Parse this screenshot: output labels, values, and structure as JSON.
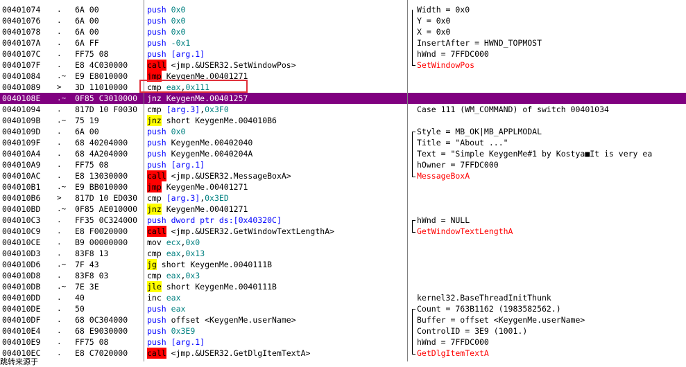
{
  "rows": [
    {
      "addr": "00401074",
      "arrow": ".",
      "hex": "6A 00",
      "mn": "push",
      "mnClass": "mn-push",
      "ops": [
        [
          "0x0",
          "op-imm"
        ]
      ],
      "cmt": "Width = 0x0"
    },
    {
      "addr": "00401076",
      "arrow": ".",
      "hex": "6A 00",
      "mn": "push",
      "mnClass": "mn-push",
      "ops": [
        [
          "0x0",
          "op-imm"
        ]
      ],
      "cmt": "Y = 0x0"
    },
    {
      "addr": "00401078",
      "arrow": ".",
      "hex": "6A 00",
      "mn": "push",
      "mnClass": "mn-push",
      "ops": [
        [
          "0x0",
          "op-imm"
        ]
      ],
      "cmt": "X = 0x0"
    },
    {
      "addr": "0040107A",
      "arrow": ".",
      "hex": "6A FF",
      "mn": "push",
      "mnClass": "mn-push",
      "ops": [
        [
          "-0x1",
          "op-imm"
        ]
      ],
      "cmt": "InsertAfter = HWND_TOPMOST"
    },
    {
      "addr": "0040107C",
      "arrow": ".",
      "hex": "FF75 08",
      "mn": "push",
      "mnClass": "mn-push",
      "ops": [
        [
          "[arg.1]",
          "op-mem"
        ]
      ],
      "cmt": "hWnd = 7FFDC000"
    },
    {
      "addr": "0040107F",
      "arrow": ".",
      "hex": "E8 4C030000",
      "mn": "call",
      "mnClass": "mn-call",
      "ops": [
        [
          "<jmp.&USER32.SetWindowPos>",
          "op-txt"
        ]
      ],
      "cmt": "SetWindowPos",
      "cmtClass": "cmt-red"
    },
    {
      "addr": "00401084",
      "arrow": ".~",
      "hex": "E9 E8010000",
      "mn": "jmp",
      "mnClass": "mn-jmp",
      "ops": [
        [
          "KeygenMe.00401271",
          "op-txt"
        ]
      ],
      "cmt": ""
    },
    {
      "addr": "00401089",
      "arrow": ">",
      "hex": "3D 11010000",
      "mn": "cmp",
      "mnClass": "mn-cmp",
      "ops": [
        [
          "eax",
          "op-reg"
        ],
        [
          ",",
          "op-txt"
        ],
        [
          "0x111",
          "op-imm"
        ]
      ],
      "cmt": ""
    },
    {
      "addr": "0040108E",
      "arrow": ".~",
      "hex": "0F85 C3010000",
      "mn": "jnz",
      "mnClass": "mn-jcc",
      "ops": [
        [
          "KeygenMe.00401257",
          "op-txt"
        ]
      ],
      "cmt": "",
      "selected": true
    },
    {
      "addr": "00401094",
      "arrow": ".",
      "hex": "817D 10 F0030",
      "mn": "cmp",
      "mnClass": "mn-cmp",
      "ops": [
        [
          "[arg.3]",
          "op-mem"
        ],
        [
          ",",
          "op-txt"
        ],
        [
          "0x3F0",
          "op-imm"
        ]
      ],
      "cmt": "Case 111 (WM_COMMAND) of switch 00401034"
    },
    {
      "addr": "0040109B",
      "arrow": ".~",
      "hex": "75 19",
      "mn": "jnz",
      "mnClass": "mn-jcc",
      "ops": [
        [
          "short KeygenMe.004010B6",
          "op-txt"
        ]
      ],
      "cmt": ""
    },
    {
      "addr": "0040109D",
      "arrow": ".",
      "hex": "6A 00",
      "mn": "push",
      "mnClass": "mn-push",
      "ops": [
        [
          "0x0",
          "op-imm"
        ]
      ],
      "cmt": "Style = MB_OK|MB_APPLMODAL"
    },
    {
      "addr": "0040109F",
      "arrow": ".",
      "hex": "68 40204000",
      "mn": "push",
      "mnClass": "mn-push",
      "ops": [
        [
          "KeygenMe.00402040",
          "op-txt"
        ]
      ],
      "cmt": "Title = \"About ...\""
    },
    {
      "addr": "004010A4",
      "arrow": ".",
      "hex": "68 4A204000",
      "mn": "push",
      "mnClass": "mn-push",
      "ops": [
        [
          "KeygenMe.0040204A",
          "op-txt"
        ]
      ],
      "cmt": "Text = \"Simple KeygenMe#1 by Kostya■It is very ea"
    },
    {
      "addr": "004010A9",
      "arrow": ".",
      "hex": "FF75 08",
      "mn": "push",
      "mnClass": "mn-push",
      "ops": [
        [
          "[arg.1]",
          "op-mem"
        ]
      ],
      "cmt": "hOwner = 7FFDC000"
    },
    {
      "addr": "004010AC",
      "arrow": ".",
      "hex": "E8 13030000",
      "mn": "call",
      "mnClass": "mn-call",
      "ops": [
        [
          "<jmp.&USER32.MessageBoxA>",
          "op-txt"
        ]
      ],
      "cmt": "MessageBoxA",
      "cmtClass": "cmt-red"
    },
    {
      "addr": "004010B1",
      "arrow": ".~",
      "hex": "E9 BB010000",
      "mn": "jmp",
      "mnClass": "mn-jmp",
      "ops": [
        [
          "KeygenMe.00401271",
          "op-txt"
        ]
      ],
      "cmt": ""
    },
    {
      "addr": "004010B6",
      "arrow": ">",
      "hex": "817D 10 ED030",
      "mn": "cmp",
      "mnClass": "mn-cmp",
      "ops": [
        [
          "[arg.3]",
          "op-mem"
        ],
        [
          ",",
          "op-txt"
        ],
        [
          "0x3ED",
          "op-imm"
        ]
      ],
      "cmt": ""
    },
    {
      "addr": "004010BD",
      "arrow": ".~",
      "hex": "0F85 AE010000",
      "mn": "jnz",
      "mnClass": "mn-jcc",
      "ops": [
        [
          "KeygenMe.00401271",
          "op-txt"
        ]
      ],
      "cmt": ""
    },
    {
      "addr": "004010C3",
      "arrow": ".",
      "hex": "FF35 0C324000",
      "mn": "push",
      "mnClass": "mn-push",
      "ops": [
        [
          "dword ptr ds:[0x40320C]",
          "op-mem"
        ]
      ],
      "cmt": "hWnd = NULL"
    },
    {
      "addr": "004010C9",
      "arrow": ".",
      "hex": "E8 F0020000",
      "mn": "call",
      "mnClass": "mn-call",
      "ops": [
        [
          "<jmp.&USER32.GetWindowTextLengthA>",
          "op-txt"
        ]
      ],
      "cmt": "GetWindowTextLengthA",
      "cmtClass": "cmt-red"
    },
    {
      "addr": "004010CE",
      "arrow": ".",
      "hex": "B9 00000000",
      "mn": "mov",
      "mnClass": "mn-mov",
      "ops": [
        [
          "ecx",
          "op-reg"
        ],
        [
          ",",
          "op-txt"
        ],
        [
          "0x0",
          "op-imm"
        ]
      ],
      "cmt": ""
    },
    {
      "addr": "004010D3",
      "arrow": ".",
      "hex": "83F8 13",
      "mn": "cmp",
      "mnClass": "mn-cmp",
      "ops": [
        [
          "eax",
          "op-reg"
        ],
        [
          ",",
          "op-txt"
        ],
        [
          "0x13",
          "op-imm"
        ]
      ],
      "cmt": ""
    },
    {
      "addr": "004010D6",
      "arrow": ".~",
      "hex": "7F 43",
      "mn": "jg",
      "mnClass": "mn-jcc",
      "ops": [
        [
          "short KeygenMe.0040111B",
          "op-txt"
        ]
      ],
      "cmt": ""
    },
    {
      "addr": "004010D8",
      "arrow": ".",
      "hex": "83F8 03",
      "mn": "cmp",
      "mnClass": "mn-cmp",
      "ops": [
        [
          "eax",
          "op-reg"
        ],
        [
          ",",
          "op-txt"
        ],
        [
          "0x3",
          "op-imm"
        ]
      ],
      "cmt": ""
    },
    {
      "addr": "004010DB",
      "arrow": ".~",
      "hex": "7E 3E",
      "mn": "jle",
      "mnClass": "mn-jcc",
      "ops": [
        [
          "short KeygenMe.0040111B",
          "op-txt"
        ]
      ],
      "cmt": ""
    },
    {
      "addr": "004010DD",
      "arrow": ".",
      "hex": "40",
      "mn": "inc",
      "mnClass": "mn-inc",
      "ops": [
        [
          "eax",
          "op-reg"
        ]
      ],
      "cmt": "kernel32.BaseThreadInitThunk"
    },
    {
      "addr": "004010DE",
      "arrow": ".",
      "hex": "50",
      "mn": "push",
      "mnClass": "mn-push",
      "ops": [
        [
          "eax",
          "op-reg"
        ]
      ],
      "cmt": "Count = 763B1162 (1983582562.)"
    },
    {
      "addr": "004010DF",
      "arrow": ".",
      "hex": "68 0C304000",
      "mn": "push",
      "mnClass": "mn-push",
      "ops": [
        [
          "offset <KeygenMe.userName>",
          "op-txt"
        ]
      ],
      "cmt": "Buffer = offset <KeygenMe.userName>"
    },
    {
      "addr": "004010E4",
      "arrow": ".",
      "hex": "68 E9030000",
      "mn": "push",
      "mnClass": "mn-push",
      "ops": [
        [
          "0x3E9",
          "op-imm"
        ]
      ],
      "cmt": "ControlID = 3E9 (1001.)"
    },
    {
      "addr": "004010E9",
      "arrow": ".",
      "hex": "FF75 08",
      "mn": "push",
      "mnClass": "mn-push",
      "ops": [
        [
          "[arg.1]",
          "op-mem"
        ]
      ],
      "cmt": "hWnd = 7FFDC000"
    },
    {
      "addr": "004010EC",
      "arrow": ".",
      "hex": "E8 C7020000",
      "mn": "call",
      "mnClass": "mn-call",
      "ops": [
        [
          "<jmp.&USER32.GetDlgItemTextA>",
          "op-txt"
        ]
      ],
      "cmt": "GetDlgItemTextA",
      "cmtClass": "cmt-red"
    }
  ],
  "footer": "跳转来源于"
}
